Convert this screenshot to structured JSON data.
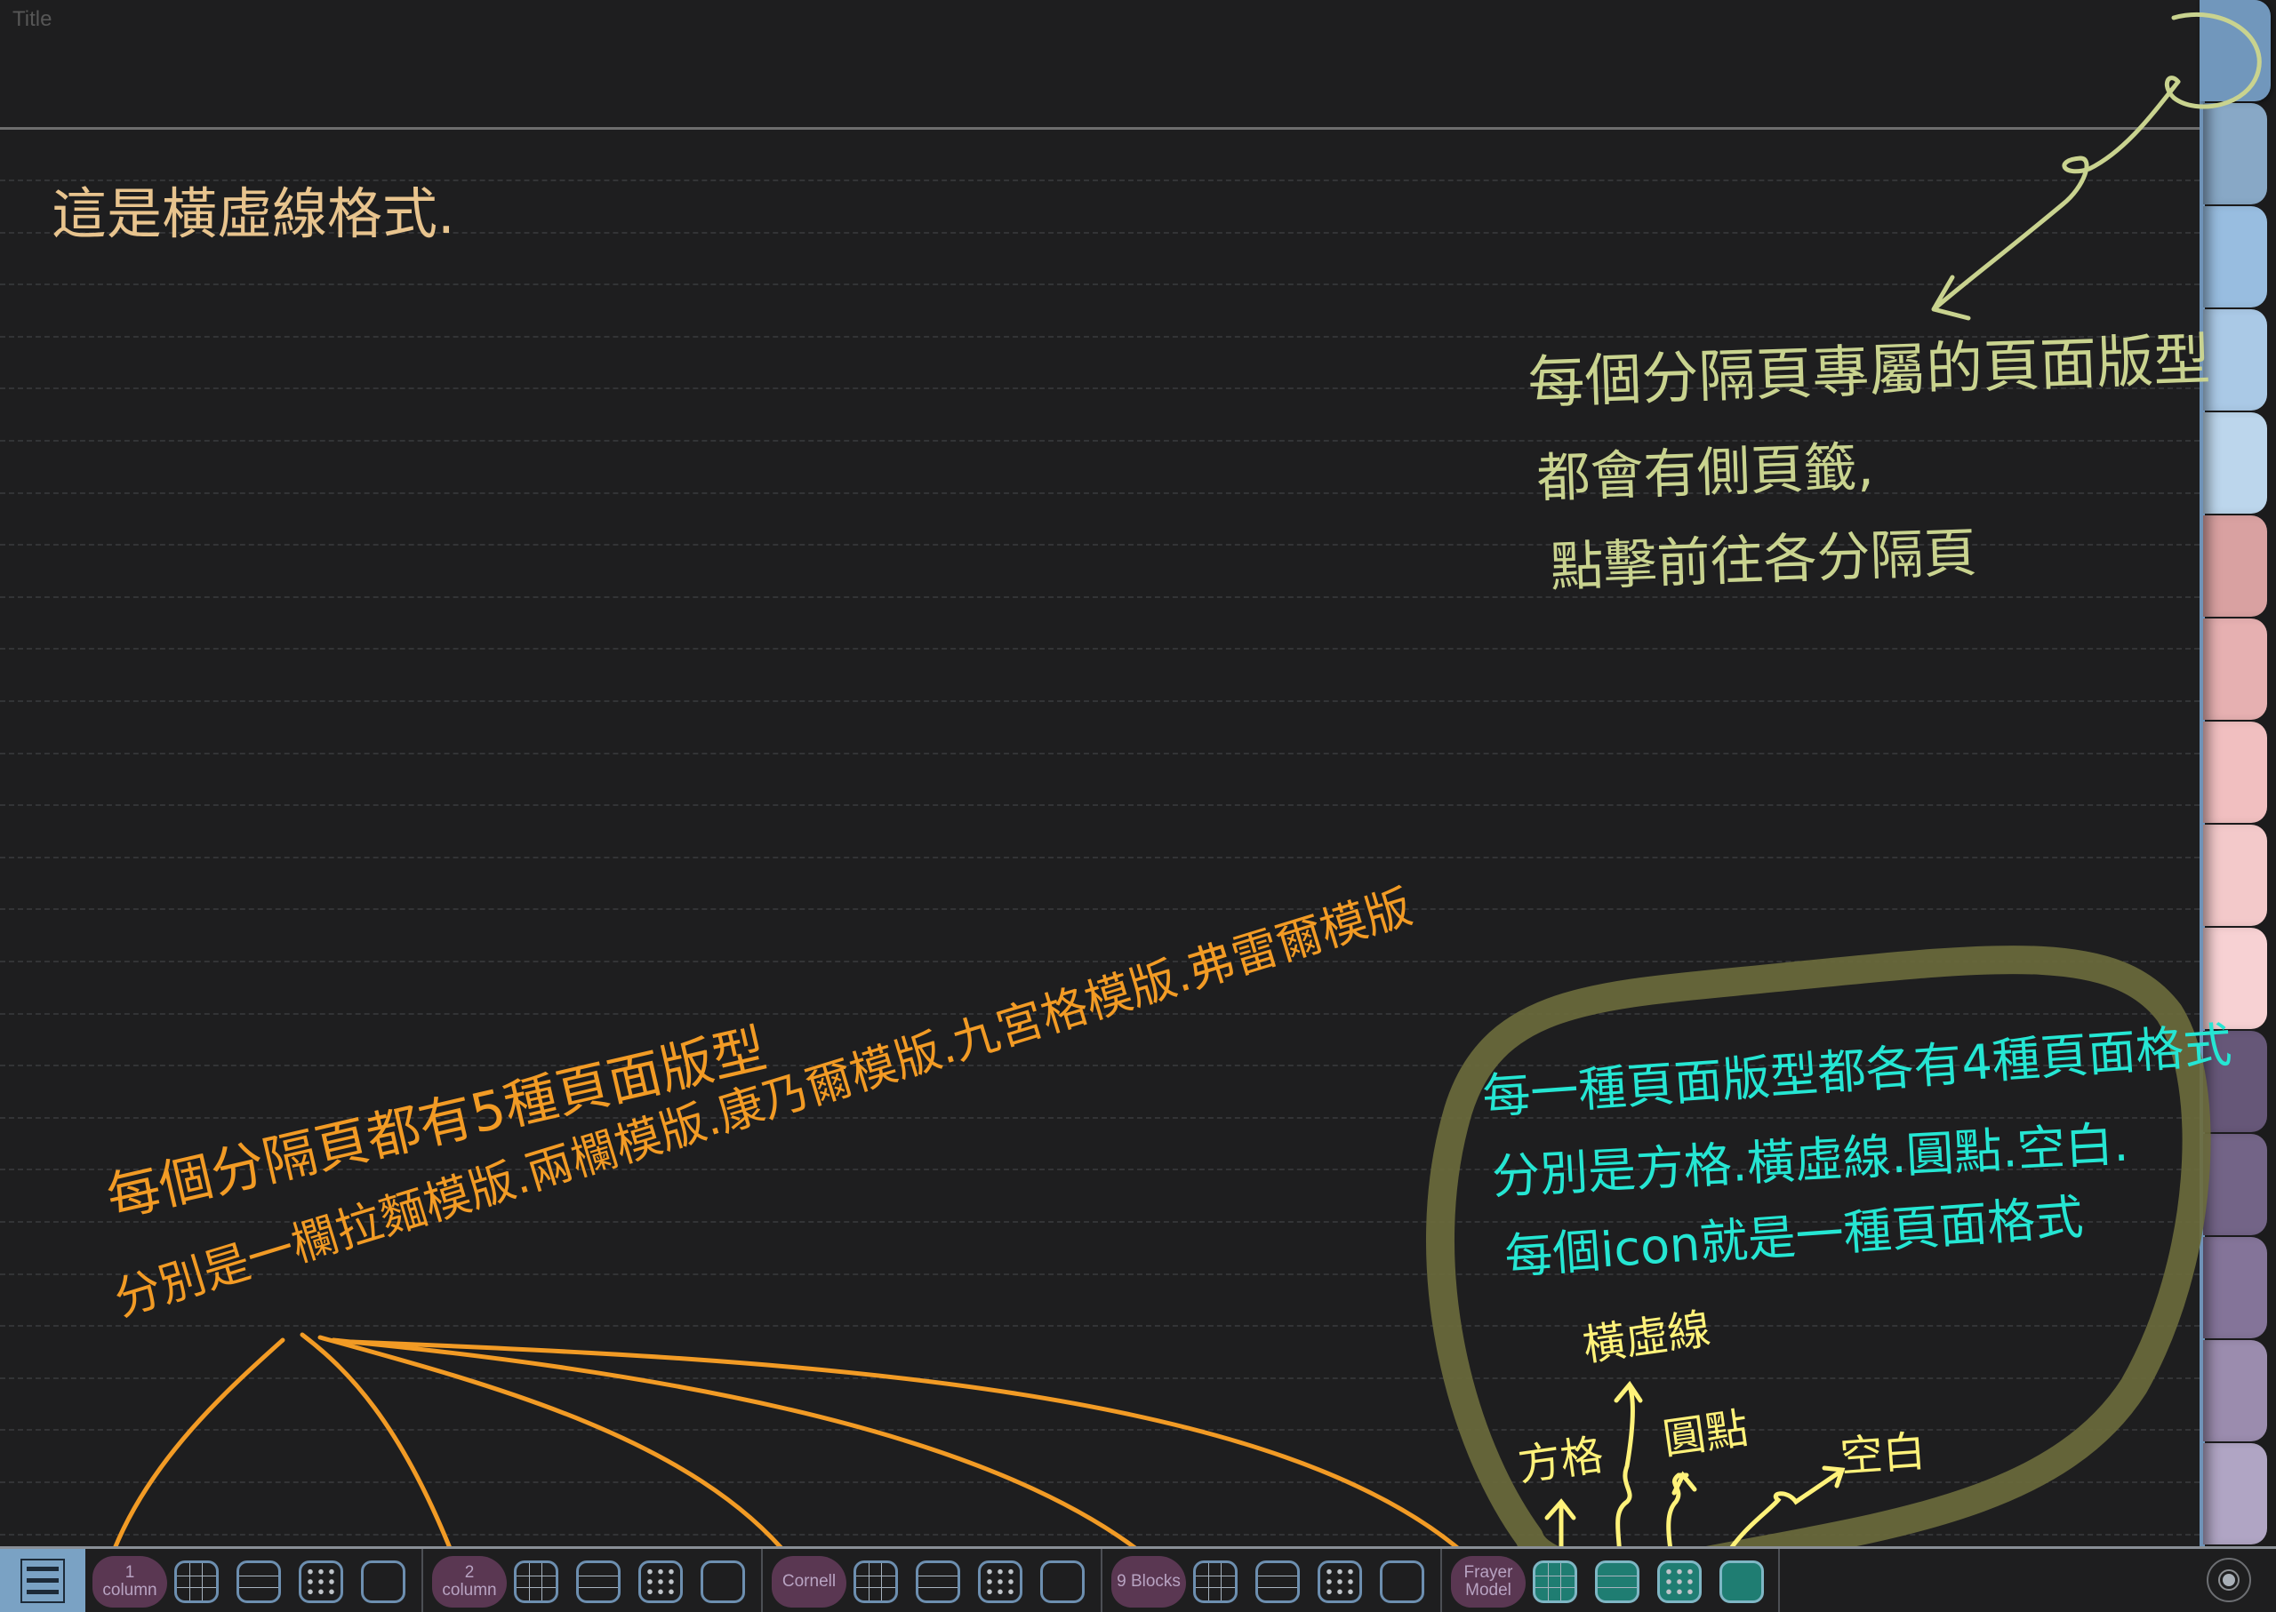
{
  "page": {
    "title_placeholder": "Title",
    "background": "#1e1e1f",
    "ruling": "dashed horizontal lines"
  },
  "annotations": {
    "heading_note": {
      "text": "這是橫虛線格式.",
      "color": "#e8c48e"
    },
    "tab_note": {
      "lines": [
        "每個分隔頁專屬的頁面版型",
        "都會有側頁籤,",
        "點擊前往各分隔頁"
      ],
      "color": "#c9d38f"
    },
    "layout_note": {
      "lines": [
        "每個分隔頁都有5種頁面版型",
        "分別是一欄拉麵模版.兩欄模版.康乃爾模版.九宮格模版.弗雷爾模版"
      ],
      "struck_word": "拉麵",
      "color": "#f29b25"
    },
    "format_note": {
      "lines": [
        "每一種頁面版型都各有4種頁面格式",
        "分別是方格.橫虛線.圓點.空白.",
        "每個icon就是一種頁面格式"
      ],
      "color": "#25e6d3"
    },
    "format_labels": {
      "items": [
        "方格",
        "橫虛線",
        "圓點",
        "空白"
      ],
      "color": "#fff27a"
    },
    "highlight_loop_color": "#6b6b3c"
  },
  "side_tabs": {
    "items": [
      {
        "index": 1,
        "color": "#7197bc",
        "active": true
      },
      {
        "index": 2,
        "color": "#88a8c6",
        "active": false
      },
      {
        "index": 3,
        "color": "#98bde0",
        "active": false
      },
      {
        "index": 4,
        "color": "#aac9e6",
        "active": false
      },
      {
        "index": 5,
        "color": "#bcd6ec",
        "active": false
      },
      {
        "index": 6,
        "color": "#d9a1a1",
        "active": false
      },
      {
        "index": 7,
        "color": "#e6b0b1",
        "active": false
      },
      {
        "index": 8,
        "color": "#f1bfc0",
        "active": false
      },
      {
        "index": 9,
        "color": "#f3c9ca",
        "active": false
      },
      {
        "index": 10,
        "color": "#f7d1d3",
        "active": false
      },
      {
        "index": 11,
        "color": "#665778",
        "active": false
      },
      {
        "index": 12,
        "color": "#736487",
        "active": false
      },
      {
        "index": 13,
        "color": "#847499",
        "active": false
      },
      {
        "index": 14,
        "color": "#9b8cae",
        "active": false
      },
      {
        "index": 15,
        "color": "#b0a5c4",
        "active": false
      }
    ]
  },
  "toolbar": {
    "menu_icon": "hamburger-menu-icon",
    "groups": [
      {
        "label_line1": "1",
        "label_line2": "column",
        "formats": [
          "grid",
          "lines",
          "dots",
          "blank"
        ]
      },
      {
        "label_line1": "2",
        "label_line2": "column",
        "formats": [
          "grid",
          "lines",
          "dots",
          "blank"
        ]
      },
      {
        "label_line1": "Cornell",
        "label_line2": "",
        "formats": [
          "grid",
          "lines",
          "dots",
          "blank"
        ]
      },
      {
        "label_line1": "9 Blocks",
        "label_line2": "",
        "formats": [
          "grid",
          "lines",
          "dots",
          "blank"
        ]
      },
      {
        "label_line1": "Frayer",
        "label_line2": "Model",
        "formats": [
          "grid",
          "lines",
          "dots",
          "blank"
        ]
      }
    ],
    "format_names": {
      "grid": "方格",
      "lines": "橫虛線",
      "dots": "圓點",
      "blank": "空白"
    },
    "home_icon": "home-target-icon"
  }
}
